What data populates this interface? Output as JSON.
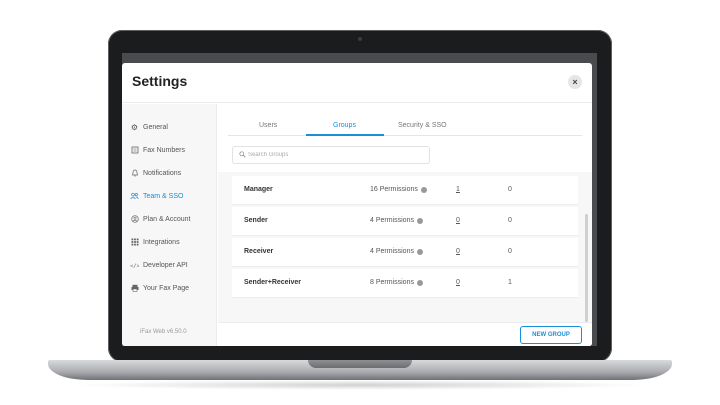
{
  "dialog": {
    "title": "Settings",
    "close_label": "×"
  },
  "sidebar": {
    "items": [
      {
        "label": "General",
        "icon": "gear-icon"
      },
      {
        "label": "Fax Numbers",
        "icon": "fax-icon"
      },
      {
        "label": "Notifications",
        "icon": "bell-icon"
      },
      {
        "label": "Team & SSO",
        "icon": "team-icon"
      },
      {
        "label": "Plan & Account",
        "icon": "account-icon"
      },
      {
        "label": "Integrations",
        "icon": "grid-icon"
      },
      {
        "label": "Developer API",
        "icon": "api-icon"
      },
      {
        "label": "Your Fax Page",
        "icon": "page-icon"
      }
    ],
    "active": "Team & SSO",
    "version": "iFax Web v6.50.0"
  },
  "tabs": [
    {
      "label": "Users"
    },
    {
      "label": "Groups"
    },
    {
      "label": "Security & SSO"
    }
  ],
  "search": {
    "placeholder": "Search Groups"
  },
  "groups": [
    {
      "name": "Manager",
      "permissions": "16 Permissions",
      "members": "1",
      "count": "0"
    },
    {
      "name": "Sender",
      "permissions": "4 Permissions",
      "members": "0",
      "count": "0"
    },
    {
      "name": "Receiver",
      "permissions": "4 Permissions",
      "members": "0",
      "count": "0"
    },
    {
      "name": "Sender+Receiver",
      "permissions": "8 Permissions",
      "members": "0",
      "count": "1"
    }
  ],
  "footer": {
    "new_group_label": "NEW GROUP"
  },
  "colors": {
    "accent": "#1a8fd6",
    "laptop_frame": "#1b1c1e"
  }
}
